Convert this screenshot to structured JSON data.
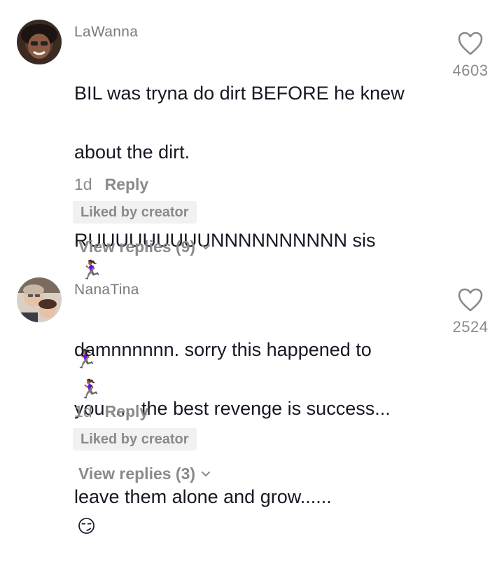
{
  "comments": [
    {
      "username": "LaWanna",
      "text_line1": "BIL was tryna do dirt BEFORE he knew",
      "text_line2": "about the dirt.",
      "text_line3": "RUUUUUUUUUNNNNNNNNNN sis",
      "emoji_runner": "🏃🏾‍♀️",
      "time": "1d",
      "reply_label": "Reply",
      "liked_label": "Liked by creator",
      "view_replies_label": "View replies (9)",
      "like_count": "4603",
      "avatar_icon": "profile-photo",
      "heart_icon": "heart-outline"
    },
    {
      "username": "NanaTina",
      "text_line1": "damnnnnnn. sorry this happened to",
      "text_line2": "you...... the best revenge is success...",
      "text_line3": "leave them alone and grow......",
      "emoji_smirk": "😏",
      "time": "1d",
      "reply_label": "Reply",
      "liked_label": "Liked by creator",
      "view_replies_label": "View replies (3)",
      "like_count": "2524",
      "avatar_icon": "profile-photo",
      "heart_icon": "heart-outline"
    }
  ],
  "colors": {
    "text_primary": "#161823",
    "text_secondary": "#8a8a8a",
    "badge_bg": "#f1f1f2",
    "background": "#ffffff"
  }
}
